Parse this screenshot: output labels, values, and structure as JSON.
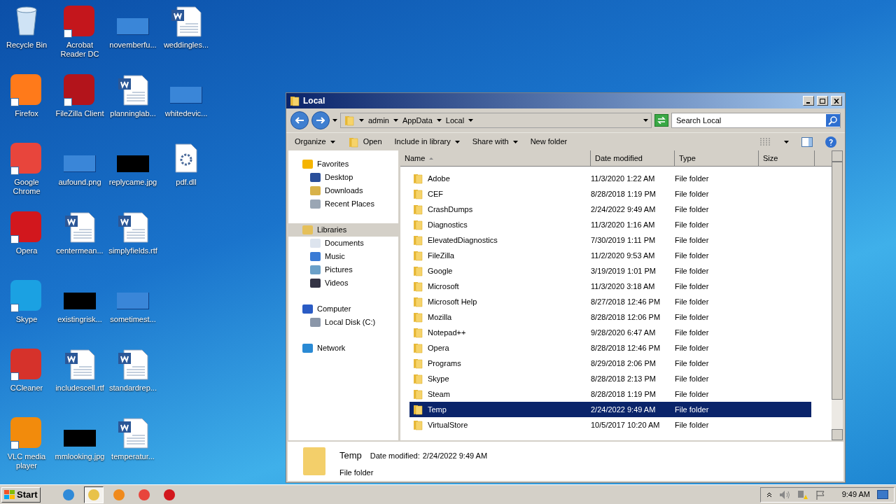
{
  "desktop": {
    "rows": [
      [
        {
          "label": "Recycle Bin",
          "kind": "recycle",
          "shortcut": false
        },
        {
          "label": "Acrobat Reader DC",
          "kind": "acrobat",
          "shortcut": true
        },
        {
          "label": "novemberfu...",
          "kind": "image-blank",
          "shortcut": false
        },
        {
          "label": "weddingles...",
          "kind": "word",
          "shortcut": false
        }
      ],
      [
        {
          "label": "Firefox",
          "kind": "firefox",
          "shortcut": true
        },
        {
          "label": "FileZilla Client",
          "kind": "filezilla",
          "shortcut": true
        },
        {
          "label": "planninglab...",
          "kind": "word",
          "shortcut": false
        },
        {
          "label": "whitedevic...",
          "kind": "image-blank",
          "shortcut": false
        }
      ],
      [
        {
          "label": "Google Chrome",
          "kind": "chrome",
          "shortcut": true
        },
        {
          "label": "aufound.png",
          "kind": "image-blank",
          "shortcut": false
        },
        {
          "label": "replycame.jpg",
          "kind": "image-dark",
          "shortcut": false
        },
        {
          "label": "pdf.dll",
          "kind": "dll",
          "shortcut": false
        }
      ],
      [
        {
          "label": "Opera",
          "kind": "opera",
          "shortcut": true
        },
        {
          "label": "centermean...",
          "kind": "word",
          "shortcut": false
        },
        {
          "label": "simplyfields.rtf",
          "kind": "word",
          "shortcut": false
        }
      ],
      [
        {
          "label": "Skype",
          "kind": "skype",
          "shortcut": true
        },
        {
          "label": "existingrisk...",
          "kind": "image-dark",
          "shortcut": false
        },
        {
          "label": "sometimest...",
          "kind": "image-blank",
          "shortcut": false
        }
      ],
      [
        {
          "label": "CCleaner",
          "kind": "ccleaner",
          "shortcut": true
        },
        {
          "label": "includescell.rtf",
          "kind": "word",
          "shortcut": false
        },
        {
          "label": "standardrep...",
          "kind": "word",
          "shortcut": false
        }
      ],
      [
        {
          "label": "VLC media player",
          "kind": "vlc",
          "shortcut": true
        },
        {
          "label": "mmlooking.jpg",
          "kind": "image-dark",
          "shortcut": false
        },
        {
          "label": "temperatur...",
          "kind": "word",
          "shortcut": false
        }
      ]
    ]
  },
  "window": {
    "title": "Local",
    "breadcrumb": [
      "admin",
      "AppData",
      "Local"
    ],
    "search": {
      "placeholder": "Search Local"
    },
    "toolbar": [
      {
        "label": "Organize",
        "kind": "menu"
      },
      {
        "label": "Open",
        "kind": "icon"
      },
      {
        "label": "Include in library",
        "kind": "menu"
      },
      {
        "label": "Share with",
        "kind": "menu"
      },
      {
        "label": "New folder",
        "kind": "plain"
      }
    ],
    "nav": [
      {
        "label": "Favorites",
        "kind": "star",
        "selected": false,
        "children": [
          {
            "label": "Desktop",
            "kind": "desktop",
            "selected": false
          },
          {
            "label": "Downloads",
            "kind": "downloads",
            "selected": false
          },
          {
            "label": "Recent Places",
            "kind": "recent",
            "selected": false
          }
        ]
      },
      {
        "label": "Libraries",
        "kind": "libraries",
        "selected": true,
        "children": [
          {
            "label": "Documents",
            "kind": "documents",
            "selected": false
          },
          {
            "label": "Music",
            "kind": "music",
            "selected": false
          },
          {
            "label": "Pictures",
            "kind": "pictures",
            "selected": false
          },
          {
            "label": "Videos",
            "kind": "videos",
            "selected": false
          }
        ]
      },
      {
        "label": "Computer",
        "kind": "computer",
        "selected": false,
        "children": [
          {
            "label": "Local Disk (C:)",
            "kind": "disk",
            "selected": false
          }
        ]
      },
      {
        "label": "Network",
        "kind": "network",
        "selected": false
      }
    ],
    "columns": [
      "Name",
      "Date modified",
      "Type",
      "Size"
    ],
    "rows": [
      {
        "name": "Adobe",
        "date": "11/3/2020 1:22 AM",
        "type": "File folder",
        "selected": false
      },
      {
        "name": "CEF",
        "date": "8/28/2018 1:19 PM",
        "type": "File folder",
        "selected": false
      },
      {
        "name": "CrashDumps",
        "date": "2/24/2022 9:49 AM",
        "type": "File folder",
        "selected": false
      },
      {
        "name": "Diagnostics",
        "date": "11/3/2020 1:16 AM",
        "type": "File folder",
        "selected": false
      },
      {
        "name": "ElevatedDiagnostics",
        "date": "7/30/2019 1:11 PM",
        "type": "File folder",
        "selected": false
      },
      {
        "name": "FileZilla",
        "date": "11/2/2020 9:53 AM",
        "type": "File folder",
        "selected": false
      },
      {
        "name": "Google",
        "date": "3/19/2019 1:01 PM",
        "type": "File folder",
        "selected": false
      },
      {
        "name": "Microsoft",
        "date": "11/3/2020 3:18 AM",
        "type": "File folder",
        "selected": false
      },
      {
        "name": "Microsoft Help",
        "date": "8/27/2018 12:46 PM",
        "type": "File folder",
        "selected": false
      },
      {
        "name": "Mozilla",
        "date": "8/28/2018 12:06 PM",
        "type": "File folder",
        "selected": false
      },
      {
        "name": "Notepad++",
        "date": "9/28/2020 6:47 AM",
        "type": "File folder",
        "selected": false
      },
      {
        "name": "Opera",
        "date": "8/28/2018 12:46 PM",
        "type": "File folder",
        "selected": false
      },
      {
        "name": "Programs",
        "date": "8/29/2018 2:06 PM",
        "type": "File folder",
        "selected": false
      },
      {
        "name": "Skype",
        "date": "8/28/2018 2:13 PM",
        "type": "File folder",
        "selected": false
      },
      {
        "name": "Steam",
        "date": "8/28/2018 1:19 PM",
        "type": "File folder",
        "selected": false
      },
      {
        "name": "Temp",
        "date": "2/24/2022 9:49 AM",
        "type": "File folder",
        "selected": true
      },
      {
        "name": "VirtualStore",
        "date": "10/5/2017 10:20 AM",
        "type": "File folder",
        "selected": false
      }
    ],
    "details": {
      "name": "Temp",
      "date_label": "Date modified:",
      "date": "2/24/2022 9:49 AM",
      "type": "File folder"
    }
  },
  "taskbar": {
    "start": "Start",
    "apps": [
      {
        "kind": "ie",
        "active": false
      },
      {
        "kind": "explorer",
        "active": true
      },
      {
        "kind": "media",
        "active": false
      },
      {
        "kind": "chrome",
        "active": false
      },
      {
        "kind": "opera",
        "active": false
      }
    ],
    "clock": "9:49 AM"
  }
}
